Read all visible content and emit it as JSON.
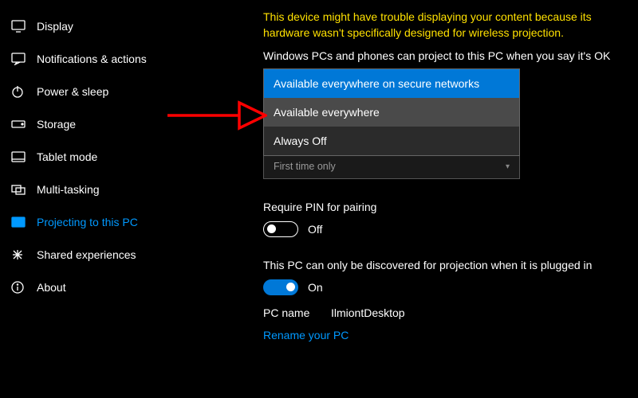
{
  "sidebar": {
    "items": [
      {
        "label": "Display",
        "icon": "display-icon"
      },
      {
        "label": "Notifications & actions",
        "icon": "notifications-icon"
      },
      {
        "label": "Power & sleep",
        "icon": "power-icon"
      },
      {
        "label": "Storage",
        "icon": "storage-icon"
      },
      {
        "label": "Tablet mode",
        "icon": "tablet-icon"
      },
      {
        "label": "Multi-tasking",
        "icon": "multitasking-icon"
      },
      {
        "label": "Projecting to this PC",
        "icon": "projecting-icon",
        "selected": true
      },
      {
        "label": "Shared experiences",
        "icon": "shared-icon"
      },
      {
        "label": "About",
        "icon": "about-icon"
      }
    ]
  },
  "content": {
    "warning": "This device might have trouble displaying your content because its hardware wasn't specifically designed for wireless projection.",
    "project_label": "Windows PCs and phones can project to this PC when you say it's OK",
    "dropdown": {
      "options": [
        "Available everywhere on secure networks",
        "Available everywhere",
        "Always Off"
      ],
      "selected_index": 0,
      "underlying_value": "First time only"
    },
    "pin": {
      "label": "Require PIN for pairing",
      "on": false,
      "state_text": "Off"
    },
    "discover": {
      "label": "This PC can only be discovered for projection when it is plugged in",
      "on": true,
      "state_text": "On"
    },
    "pcname": {
      "key": "PC name",
      "value": "IlmiontDesktop"
    },
    "rename_link": "Rename your PC"
  },
  "annotation": {
    "arrow_color": "#ff0000"
  }
}
